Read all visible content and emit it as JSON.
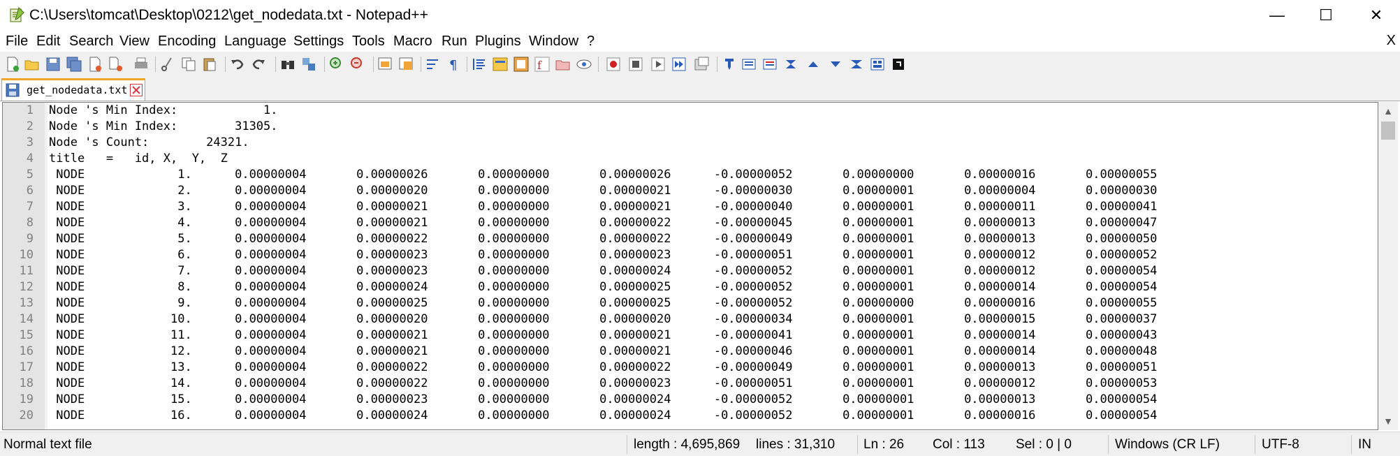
{
  "window": {
    "title": "C:\\Users\\tomcat\\Desktop\\0212\\get_nodedata.txt - Notepad++",
    "minimize": "—",
    "maximize": "☐",
    "close": "✕"
  },
  "menu": {
    "items": [
      "File",
      "Edit",
      "Search",
      "View",
      "Encoding",
      "Language",
      "Settings",
      "Tools",
      "Macro",
      "Run",
      "Plugins",
      "Window",
      "?"
    ],
    "close_doc": "X"
  },
  "toolbar": {
    "icons": [
      "new-file-icon",
      "open-file-icon",
      "save-icon",
      "save-all-icon",
      "close-icon",
      "close-all-icon",
      "print-icon",
      "cut-icon",
      "copy-icon",
      "paste-icon",
      "undo-icon",
      "redo-icon",
      "find-icon",
      "replace-icon",
      "zoom-in-icon",
      "zoom-out-icon",
      "sync-vertical-icon",
      "sync-horizontal-icon",
      "word-wrap-icon",
      "show-all-chars-icon",
      "indent-guide-icon",
      "user-language-icon",
      "document-map-icon",
      "function-list-icon",
      "folder-workspace-icon",
      "monitoring-icon",
      "record-macro-icon",
      "stop-record-icon",
      "playback-macro-icon",
      "run-macro-multiple-icon",
      "save-macro-icon"
    ],
    "plugin_icons": [
      "plugin-a-icon",
      "plugin-b-icon",
      "plugin-c-icon",
      "plugin-d-icon",
      "plugin-up-icon",
      "plugin-down-icon",
      "plugin-e-icon",
      "plugin-f-icon",
      "plugin-g-icon"
    ]
  },
  "tab": {
    "label": "get_nodedata.txt"
  },
  "editor": {
    "lines": [
      {
        "n": "1",
        "text": "Node 's Min Index:            1."
      },
      {
        "n": "2",
        "text": "Node 's Min Index:        31305."
      },
      {
        "n": "3",
        "text": "Node 's Count:        24321."
      },
      {
        "n": "4",
        "text": "title   =   id, X,  Y,  Z"
      },
      {
        "n": "5",
        "text": " NODE             1.      0.00000004       0.00000026       0.00000000       0.00000026      -0.00000052       0.00000000       0.00000016       0.00000055"
      },
      {
        "n": "6",
        "text": " NODE             2.      0.00000004       0.00000020       0.00000000       0.00000021      -0.00000030       0.00000001       0.00000004       0.00000030"
      },
      {
        "n": "7",
        "text": " NODE             3.      0.00000004       0.00000021       0.00000000       0.00000021      -0.00000040       0.00000001       0.00000011       0.00000041"
      },
      {
        "n": "8",
        "text": " NODE             4.      0.00000004       0.00000021       0.00000000       0.00000022      -0.00000045       0.00000001       0.00000013       0.00000047"
      },
      {
        "n": "9",
        "text": " NODE             5.      0.00000004       0.00000022       0.00000000       0.00000022      -0.00000049       0.00000001       0.00000013       0.00000050"
      },
      {
        "n": "10",
        "text": " NODE             6.      0.00000004       0.00000023       0.00000000       0.00000023      -0.00000051       0.00000001       0.00000012       0.00000052"
      },
      {
        "n": "11",
        "text": " NODE             7.      0.00000004       0.00000023       0.00000000       0.00000024      -0.00000052       0.00000001       0.00000012       0.00000054"
      },
      {
        "n": "12",
        "text": " NODE             8.      0.00000004       0.00000024       0.00000000       0.00000025      -0.00000052       0.00000001       0.00000014       0.00000054"
      },
      {
        "n": "13",
        "text": " NODE             9.      0.00000004       0.00000025       0.00000000       0.00000025      -0.00000052       0.00000000       0.00000016       0.00000055"
      },
      {
        "n": "14",
        "text": " NODE            10.      0.00000004       0.00000020       0.00000000       0.00000020      -0.00000034       0.00000001       0.00000015       0.00000037"
      },
      {
        "n": "15",
        "text": " NODE            11.      0.00000004       0.00000021       0.00000000       0.00000021      -0.00000041       0.00000001       0.00000014       0.00000043"
      },
      {
        "n": "16",
        "text": " NODE            12.      0.00000004       0.00000021       0.00000000       0.00000021      -0.00000046       0.00000001       0.00000014       0.00000048"
      },
      {
        "n": "17",
        "text": " NODE            13.      0.00000004       0.00000022       0.00000000       0.00000022      -0.00000049       0.00000001       0.00000013       0.00000051"
      },
      {
        "n": "18",
        "text": " NODE            14.      0.00000004       0.00000022       0.00000000       0.00000023      -0.00000051       0.00000001       0.00000012       0.00000053"
      },
      {
        "n": "19",
        "text": " NODE            15.      0.00000004       0.00000023       0.00000000       0.00000024      -0.00000052       0.00000001       0.00000013       0.00000054"
      },
      {
        "n": "20",
        "text": " NODE            16.      0.00000004       0.00000024       0.00000000       0.00000024      -0.00000052       0.00000001       0.00000016       0.00000054"
      }
    ]
  },
  "scrollbar": {
    "up": "▲",
    "down": "▼"
  },
  "status": {
    "file_type": "Normal text file",
    "length": "length : 4,695,869",
    "lines": "lines : 31,310",
    "ln": "Ln : 26",
    "col": "Col : 113",
    "sel": "Sel : 0 | 0",
    "eol": "Windows (CR LF)",
    "encoding": "UTF-8",
    "ins": "IN"
  },
  "colors": {
    "tab_accent": "#f5a524",
    "tab_close_red": "#d9343c",
    "gutter_bg": "#e4e4e4",
    "toolbar_bg": "#f0f0f0"
  }
}
